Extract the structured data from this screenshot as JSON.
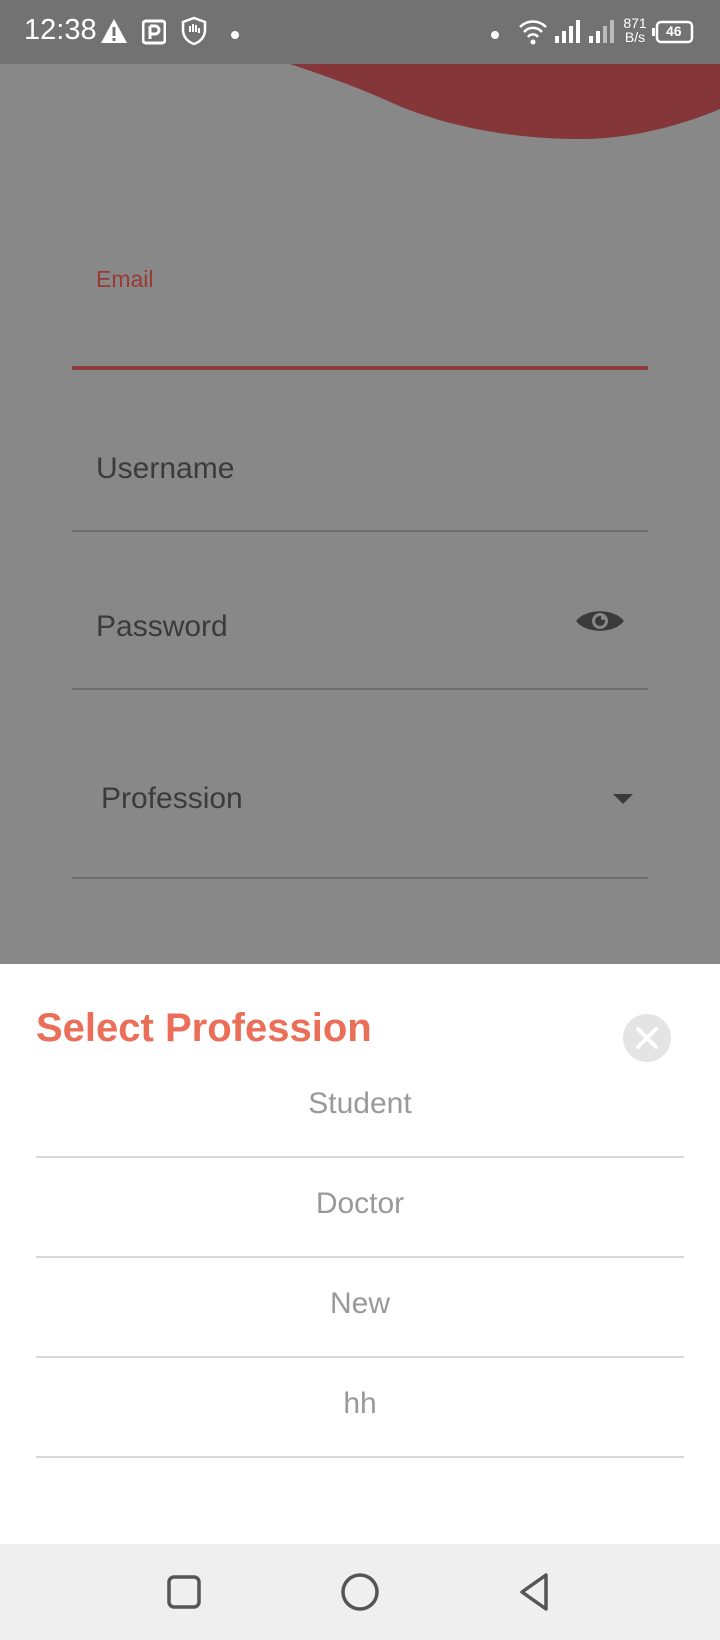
{
  "status_bar": {
    "time": "12:38",
    "net_speed_value": "871",
    "net_speed_unit": "B/s",
    "battery": "46",
    "icons_left": [
      "warning-icon",
      "parking-app-icon",
      "hand-shield-icon",
      "dot-icon"
    ],
    "icons_right": [
      "dot-icon",
      "wifi-icon",
      "signal-icon",
      "signal-icon",
      "battery-icon"
    ]
  },
  "form": {
    "email_label": "Email",
    "username_placeholder": "Username",
    "password_placeholder": "Password",
    "profession_placeholder": "Profession"
  },
  "sheet": {
    "title": "Select Profession",
    "options": [
      "Student",
      "Doctor",
      "New",
      "hh"
    ]
  },
  "colors": {
    "accent": "#ea6e58",
    "wave": "#843639",
    "scrim": "#888888"
  }
}
